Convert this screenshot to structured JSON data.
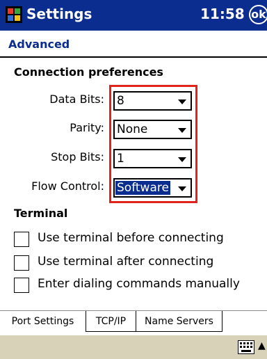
{
  "titlebar": {
    "title": "Settings",
    "time": "11:58",
    "ok_label": "ok"
  },
  "header": {
    "subtitle": "Advanced"
  },
  "connection": {
    "section_title": "Connection preferences",
    "fields": [
      {
        "label": "Data Bits:",
        "value": "8"
      },
      {
        "label": "Parity:",
        "value": "None"
      },
      {
        "label": "Stop Bits:",
        "value": "1"
      },
      {
        "label": "Flow Control:",
        "value": "Software"
      }
    ]
  },
  "terminal": {
    "section_title": "Terminal",
    "options": [
      {
        "label": "Use terminal before connecting",
        "checked": false
      },
      {
        "label": "Use terminal after connecting",
        "checked": false
      },
      {
        "label": "Enter dialing commands manually",
        "checked": false
      }
    ]
  },
  "tabs": [
    {
      "label": "Port Settings",
      "active": true
    },
    {
      "label": "TCP/IP",
      "active": false
    },
    {
      "label": "Name Servers",
      "active": false
    }
  ],
  "colors": {
    "titlebar": "#0a2d8f",
    "highlight": "#e0241b",
    "taskbar": "#d8d2b8"
  },
  "icons": {
    "logo": "windows-flag-icon",
    "keyboard": "keyboard-icon",
    "sip_arrow": "up-arrow-icon"
  }
}
